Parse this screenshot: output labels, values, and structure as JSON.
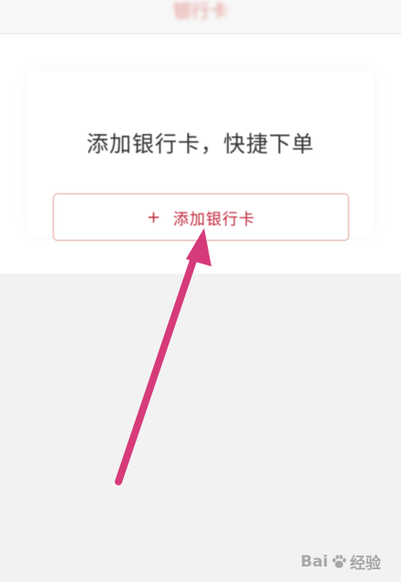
{
  "header": {
    "title": "银行卡"
  },
  "card": {
    "headline": "添加银行卡，快捷下单",
    "add_button": {
      "plus_symbol": "+",
      "label": "添加银行卡"
    }
  },
  "watermark": {
    "text_left": "Bai",
    "icon": "paw-icon",
    "text_right": "经验"
  },
  "colors": {
    "accent": "#c0283a",
    "button_border": "#e09a9a",
    "arrow": "#d63a7a"
  }
}
